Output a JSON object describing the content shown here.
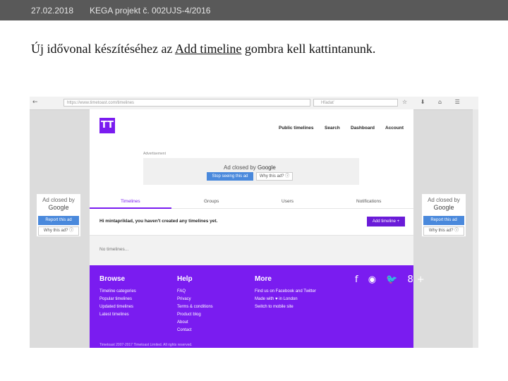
{
  "slide": {
    "date": "27.02.2018",
    "project": "KEGA projekt č. 002UJS-4/2016",
    "heading_before": "Új idővonal készítéséhez az ",
    "heading_link": "Add timeline",
    "heading_after": " gombra kell kattintanunk."
  },
  "browser": {
    "url": "https://www.timetoast.com/timelines",
    "search_placeholder": "Hľadať",
    "back": "←",
    "nav_icons": "☆ ⬇ ⌂ ☰"
  },
  "site": {
    "logo_text": "TT",
    "nav": [
      "Public timelines",
      "Search",
      "Dashboard",
      "Account"
    ],
    "top_ad": {
      "label": "Advertisement",
      "closed_text": "Ad closed by",
      "brand": "Google",
      "stop_label": "Stop seeing this ad",
      "why_label": "Why this ad? ⓘ"
    },
    "tabs": [
      "Timelines",
      "Groups",
      "Users",
      "Notifications"
    ],
    "message": "Hi mintapriklad, you haven't created any timelines yet.",
    "add_button": "Add timeline +",
    "empty_text": "No timelines...",
    "footer": {
      "browse_title": "Browse",
      "browse_links": [
        "Timeline categories",
        "Popular timelines",
        "Updated timelines",
        "Latest timelines"
      ],
      "help_title": "Help",
      "help_links": [
        "FAQ",
        "Privacy",
        "Terms & conditions",
        "Product blog",
        "About",
        "Contact"
      ],
      "more_title": "More",
      "more_links": [
        "Find us on Facebook and Twitter",
        "Made with ♥ in London",
        "Switch to mobile site"
      ],
      "social": "f ◉ 🐦 8+",
      "copyright": "Timetoast 2007-2017 Timetoast Limited. All rights reserved."
    }
  },
  "side_ads": {
    "closed_text": "Ad closed by",
    "brand": "Google",
    "report_label": "Report this ad",
    "why_label": "Why this ad? ⓘ"
  }
}
